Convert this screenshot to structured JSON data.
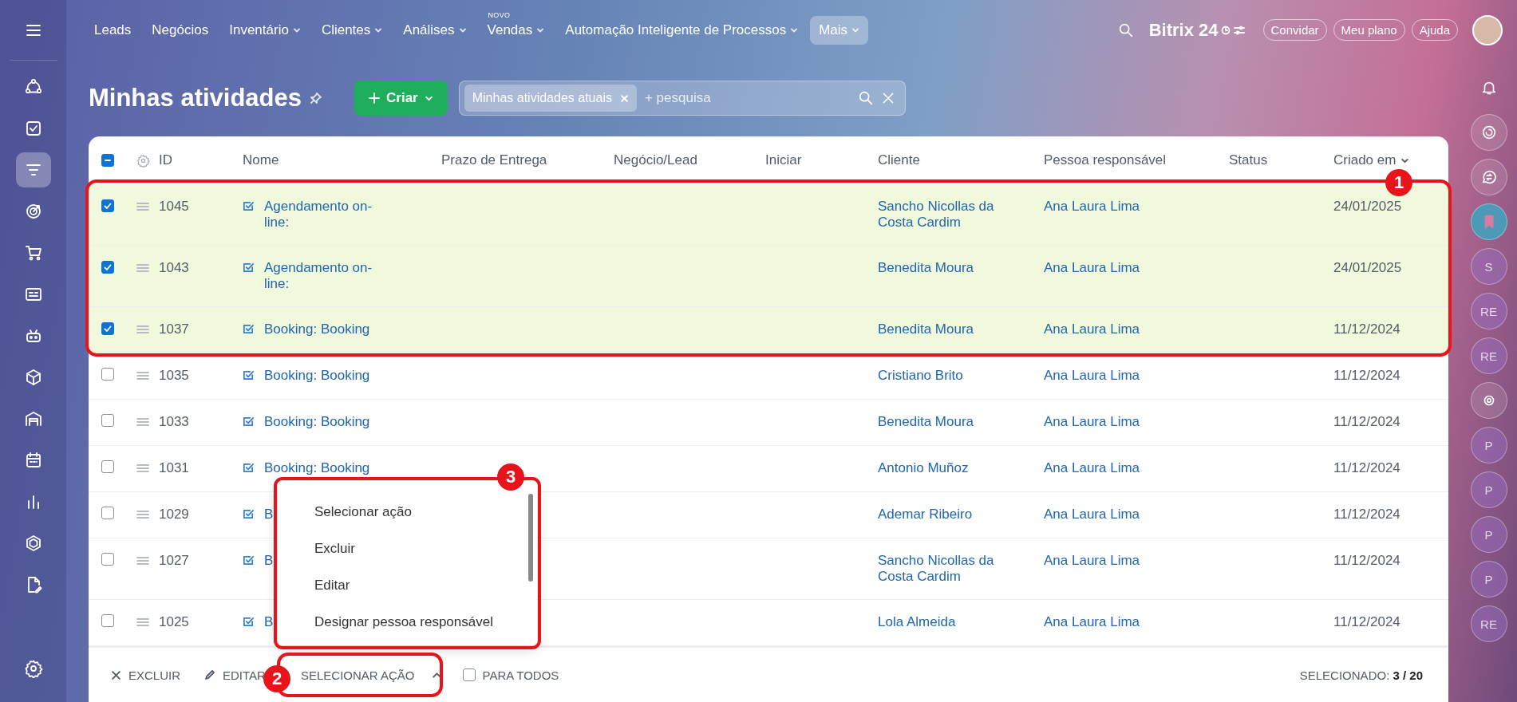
{
  "sidebar": {
    "items": [
      {
        "selected": false
      },
      {
        "selected": false
      },
      {
        "selected": true
      },
      {
        "selected": false
      },
      {
        "selected": false
      },
      {
        "selected": false
      },
      {
        "selected": false
      },
      {
        "selected": false
      },
      {
        "selected": false
      },
      {
        "selected": false
      },
      {
        "selected": false
      },
      {
        "selected": false
      },
      {
        "selected": false
      }
    ]
  },
  "top_nav": {
    "items": [
      {
        "label": "Leads",
        "dropdown": false,
        "selected": false
      },
      {
        "label": "Negócios",
        "dropdown": false,
        "selected": false
      },
      {
        "label": "Inventário",
        "dropdown": true,
        "selected": false
      },
      {
        "label": "Clientes",
        "dropdown": true,
        "selected": false
      },
      {
        "label": "Análises",
        "dropdown": true,
        "selected": false
      },
      {
        "label": "Vendas",
        "dropdown": true,
        "selected": false,
        "badge": "NOVO"
      },
      {
        "label": "Automação Inteligente de Processos",
        "dropdown": true,
        "selected": false
      },
      {
        "label": "Mais",
        "dropdown": true,
        "selected": true
      }
    ]
  },
  "logo": "Bitrix 24",
  "top_buttons": [
    "Convidar",
    "Meu plano",
    "Ajuda"
  ],
  "page_title": "Minhas atividades",
  "create_button": "Criar",
  "filter": {
    "tag": "Minhas atividades atuais",
    "placeholder": "+ pesquisa"
  },
  "table": {
    "select_all": {
      "indeterminate": true
    },
    "columns": [
      "ID",
      "Nome",
      "Prazo de Entrega",
      "Negócio/Lead",
      "Iniciar",
      "Cliente",
      "Pessoa responsável",
      "Status",
      "Criado em"
    ],
    "rows": [
      {
        "checked": true,
        "id": "1045",
        "name": "Agendamento on-line:",
        "client": "Sancho Nicollas da Costa Cardim",
        "responsible": "Ana Laura Lima",
        "created": "24/01/2025"
      },
      {
        "checked": true,
        "id": "1043",
        "name": "Agendamento on-line:",
        "client": "Benedita Moura",
        "responsible": "Ana Laura Lima",
        "created": "24/01/2025"
      },
      {
        "checked": true,
        "id": "1037",
        "name": "Booking: Booking",
        "client": "Benedita Moura",
        "responsible": "Ana Laura Lima",
        "created": "11/12/2024"
      },
      {
        "checked": false,
        "id": "1035",
        "name": "Booking: Booking",
        "client": "Cristiano Brito",
        "responsible": "Ana Laura Lima",
        "created": "11/12/2024"
      },
      {
        "checked": false,
        "id": "1033",
        "name": "Booking: Booking",
        "client": "Benedita Moura",
        "responsible": "Ana Laura Lima",
        "created": "11/12/2024"
      },
      {
        "checked": false,
        "id": "1031",
        "name": "Booking: Booking",
        "client": "Antonio Muñoz",
        "responsible": "Ana Laura Lima",
        "created": "11/12/2024"
      },
      {
        "checked": false,
        "id": "1029",
        "name": "B",
        "client": "Ademar Ribeiro",
        "responsible": "Ana Laura Lima",
        "created": "11/12/2024"
      },
      {
        "checked": false,
        "id": "1027",
        "name": "B",
        "client": "Sancho Nicollas da Costa Cardim",
        "responsible": "Ana Laura Lima",
        "created": "11/12/2024"
      },
      {
        "checked": false,
        "id": "1025",
        "name": "B",
        "client": "Lola Almeida",
        "responsible": "Ana Laura Lima",
        "created": "11/12/2024"
      }
    ]
  },
  "action_menu": {
    "items": [
      "Selecionar ação",
      "Excluir",
      "Editar",
      "Designar pessoa responsável"
    ]
  },
  "action_bar": {
    "delete": "EXCLUIR",
    "edit": "EDITAR",
    "select_action": {
      "label": "SELECIONAR AÇÃO",
      "expanded": true
    },
    "for_all": {
      "label": "PARA TODOS",
      "checked": false
    },
    "selected_count": "SELECIONADO: **3 / 20**"
  },
  "right_panel": [
    {
      "kind": "icon"
    },
    {
      "kind": "icon"
    },
    {
      "kind": "icon"
    },
    {
      "kind": "bookmark"
    },
    {
      "kind": "avatar",
      "initials": "S"
    },
    {
      "kind": "avatar",
      "initials": "RE"
    },
    {
      "kind": "avatar",
      "initials": "RE"
    },
    {
      "kind": "icon"
    },
    {
      "kind": "avatar",
      "initials": "P"
    },
    {
      "kind": "avatar",
      "initials": "P"
    },
    {
      "kind": "avatar",
      "initials": "P"
    },
    {
      "kind": "avatar",
      "initials": "P"
    },
    {
      "kind": "avatar",
      "initials": "RE"
    }
  ],
  "annotations": [
    {
      "number": "1"
    },
    {
      "number": "2"
    },
    {
      "number": "3"
    }
  ]
}
